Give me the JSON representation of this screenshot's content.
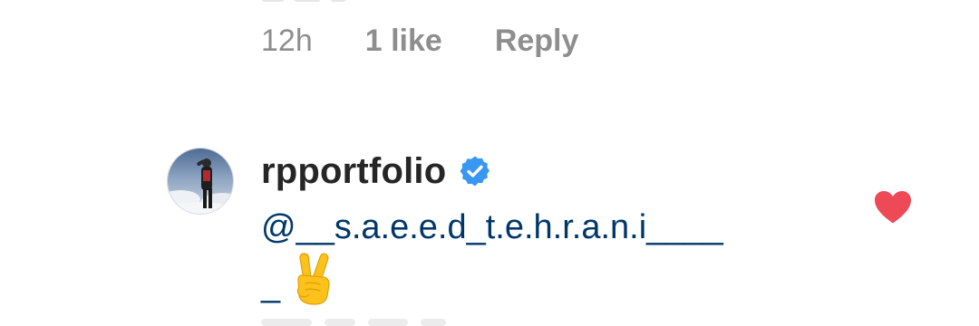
{
  "previous_comment": {
    "time": "12h",
    "likes": "1 like",
    "reply_label": "Reply"
  },
  "comment": {
    "username": "rpportfolio",
    "verified": true,
    "mention": "@__s.a.e.e.d_t.e.h.r.a.n.i____",
    "mention_tail": "_",
    "emoji": "✌️",
    "liked": true
  },
  "colors": {
    "meta_text": "#8e8e8e",
    "username_text": "#262626",
    "mention_text": "#00376b",
    "verified_badge": "#3897f0",
    "heart": "#ed4956"
  },
  "icons": {
    "verified": "verified-badge-icon",
    "like": "heart-icon",
    "emoji": "victory-hand-emoji-icon"
  }
}
